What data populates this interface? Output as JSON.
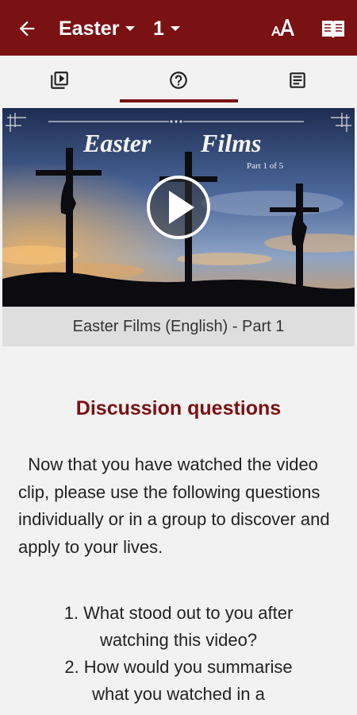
{
  "appbar": {
    "book": "Easter",
    "chapter": "1",
    "icons": [
      "back-arrow-icon",
      "text-size-icon",
      "reader-book-icon"
    ]
  },
  "tabs": [
    {
      "name": "video",
      "icon": "video-library-icon",
      "selected": false
    },
    {
      "name": "questions",
      "icon": "help-circle-icon",
      "selected": true
    },
    {
      "name": "notes",
      "icon": "notes-icon",
      "selected": false
    }
  ],
  "video": {
    "title_art_line1": "Easter",
    "title_art_line2": "Films",
    "part_art": "Part 1 of 5",
    "caption": "Easter Films (English) - Part 1"
  },
  "content": {
    "heading": "Discussion questions",
    "intro": "Now that you have watched the video clip, please use the following questions individually or in a group to discover and apply to your lives.",
    "questions": [
      {
        "line1": "1. What stood out to you after",
        "line2": "watching this video?"
      },
      {
        "line1": "2. How would you summarise",
        "line2": "what you watched in a"
      }
    ]
  },
  "colors": {
    "brand": "#7a1113",
    "background": "#f2f2f2",
    "caption_bg": "#dedede"
  }
}
